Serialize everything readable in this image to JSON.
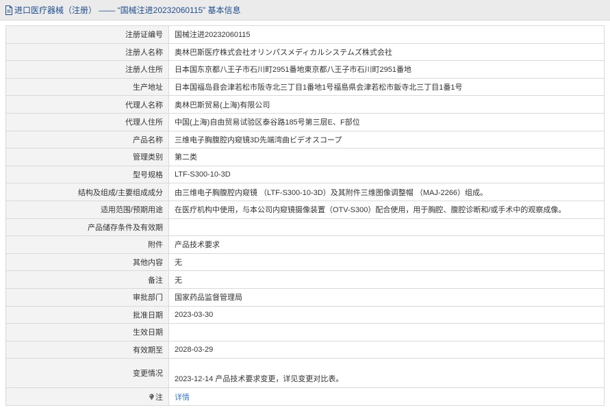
{
  "header": {
    "title": "进口医疗器械（注册）  ——  “国械注进20232060115” 基本信息",
    "icon": "document-icon",
    "color": "#1e4e8f"
  },
  "rows": [
    {
      "label": "注册证编号",
      "value": "国械注进20232060115"
    },
    {
      "label": "注册人名称",
      "value": "奥林巴斯医疗株式会社オリンパスメディカルシステムズ株式会社"
    },
    {
      "label": "注册人住所",
      "value": "日本国东京都八王子市石川町2951番地東京都八王子市石川町2951番地"
    },
    {
      "label": "生产地址",
      "value": "日本国福岛县会津若松市阪寺北三丁目1番地1号福島県会津若松市鈑寺北三丁目1番1号"
    },
    {
      "label": "代理人名称",
      "value": "奥林巴斯贸易(上海)有限公司"
    },
    {
      "label": "代理人住所",
      "value": "中国(上海)自由贸易试验区泰谷路185号第三层E、F部位"
    },
    {
      "label": "产品名称",
      "value": "三维电子胸腹腔内窥镜3D先端湾曲ビデオスコープ"
    },
    {
      "label": "管理类别",
      "value": "第二类"
    },
    {
      "label": "型号规格",
      "value": "LTF-S300-10-3D"
    },
    {
      "label": "结构及组成/主要组成成分",
      "value": "由三维电子胸腹腔内窥镜 （LTF-S300-10-3D）及其附件三维图像调整帽 （MAJ-2266）组成。"
    },
    {
      "label": "适用范围/预期用途",
      "value": "在医疗机构中使用，与本公司内窥镜摄像装置（OTV-S300）配合使用，用于胸腔、腹腔诊断和/或手术中的观察成像。"
    },
    {
      "label": "产品储存条件及有效期",
      "value": ""
    },
    {
      "label": "附件",
      "value": "产品技术要求"
    },
    {
      "label": "其他内容",
      "value": "无"
    },
    {
      "label": "备注",
      "value": "无"
    },
    {
      "label": "审批部门",
      "value": "国家药品监督管理局"
    },
    {
      "label": "批准日期",
      "value": "2023-03-30"
    },
    {
      "label": "生效日期",
      "value": ""
    },
    {
      "label": "有效期至",
      "value": "2028-03-29"
    },
    {
      "label": "变更情况",
      "value": "2023-12-14 产品技术要求变更，详见变更对比表。"
    }
  ],
  "note": {
    "label": "注",
    "icon": "pin-icon",
    "link_text": "详情",
    "link_color": "#3d7bd1"
  }
}
